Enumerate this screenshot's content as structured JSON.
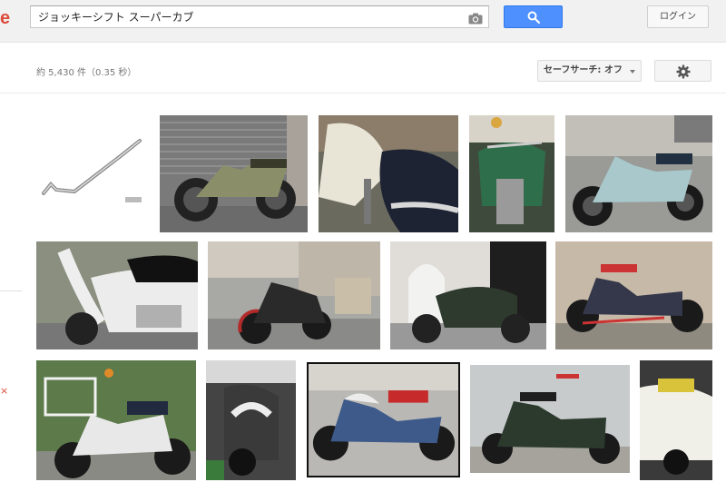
{
  "search": {
    "query": "ジョッキーシフト スーパーカブ",
    "camera_icon": "camera-icon",
    "search_icon": "search-icon"
  },
  "header": {
    "logo_fragment": "e",
    "login_label": "ログイン"
  },
  "toolbar": {
    "results_count": "約 5,430 件（0.35 秒）",
    "safesearch_label": "セーフサーチ: オフ",
    "settings_icon": "gear-icon"
  },
  "results": {
    "rows": [
      {
        "images": [
          "shift-lever-product",
          "motorcycle-olive-garage-door",
          "motorcycle-seat-closeup",
          "motorcycle-green-handlebar",
          "motorcycle-lightblue-street"
        ]
      },
      {
        "images": [
          "motorcycle-white-closeup",
          "motorcycle-black-street",
          "motorcycle-white-crate",
          "motorcycle-navy-red-seat"
        ]
      },
      {
        "images": [
          "motorcycle-white-basket",
          "motorcycle-dark-partial",
          "motorcycle-blue-red-seat",
          "motorcycle-dark-green-fence",
          "motorcycle-partial-edge"
        ]
      }
    ]
  },
  "colors": {
    "search_blue": "#4d90fe",
    "topbar_bg": "#f1f1f1",
    "logo_red": "#dd4b39"
  }
}
